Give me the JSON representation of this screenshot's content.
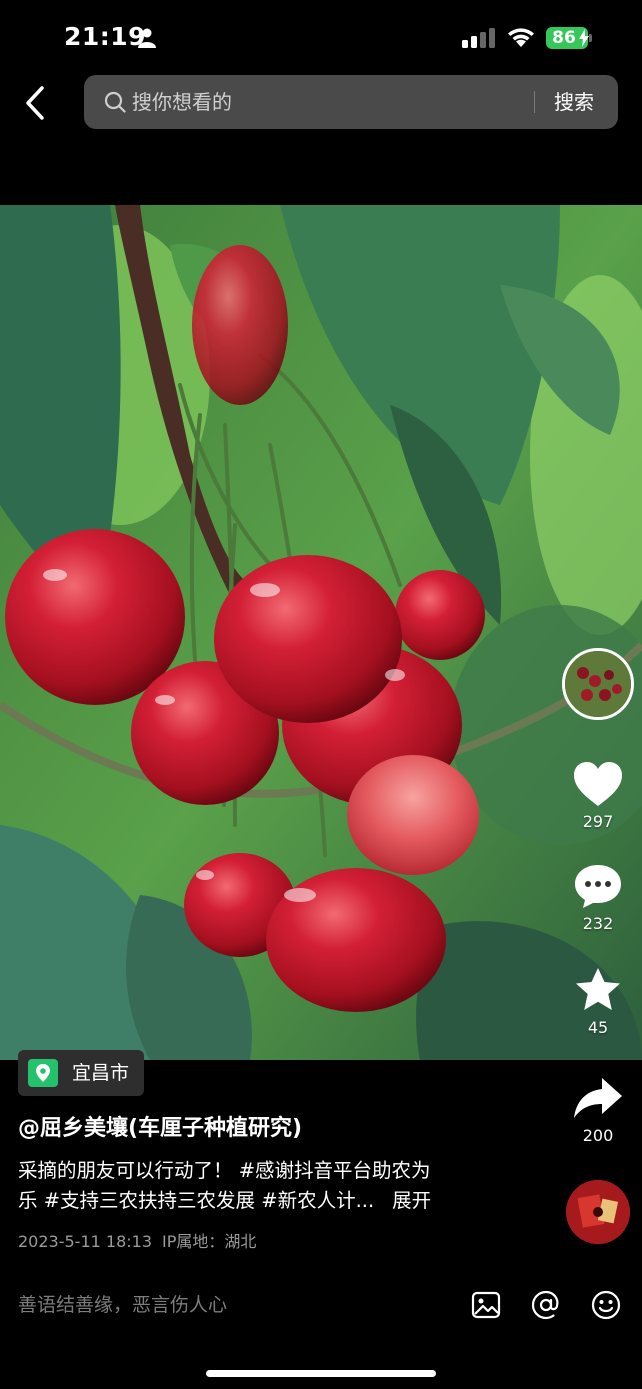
{
  "status_bar": {
    "time": "21:19",
    "battery": "86",
    "icons": [
      "person-icon",
      "signal-icon",
      "wifi-icon",
      "battery-icon"
    ]
  },
  "nav": {
    "back_icon": "chevron-left-icon",
    "search_placeholder": "搜你想看的",
    "search_button": "搜索"
  },
  "video": {
    "subject": "cherries"
  },
  "actions": {
    "like_count": "297",
    "comment_count": "232",
    "favorite_count": "45",
    "share_count": "200"
  },
  "post": {
    "location": "宜昌市",
    "author": "@屈乡美壤(车厘子种植研究)",
    "description_line1": "采摘的朋友可以行动了！ #感谢抖音平台助农为",
    "description_line2": "乐 #支持三农扶持三农发展 #新农人计...",
    "expand": "展开",
    "date": "2023-5-11 18:13",
    "ip": "IP属地：湖北"
  },
  "comment_bar": {
    "placeholder": "善语结善缘，恶言伤人心",
    "tools": [
      "image-icon",
      "at-icon",
      "emoji-icon"
    ]
  },
  "colors": {
    "background": "#000000",
    "battery": "#35c759",
    "location_pin": "#25c26e",
    "search_bg": "#4a4a4a"
  }
}
